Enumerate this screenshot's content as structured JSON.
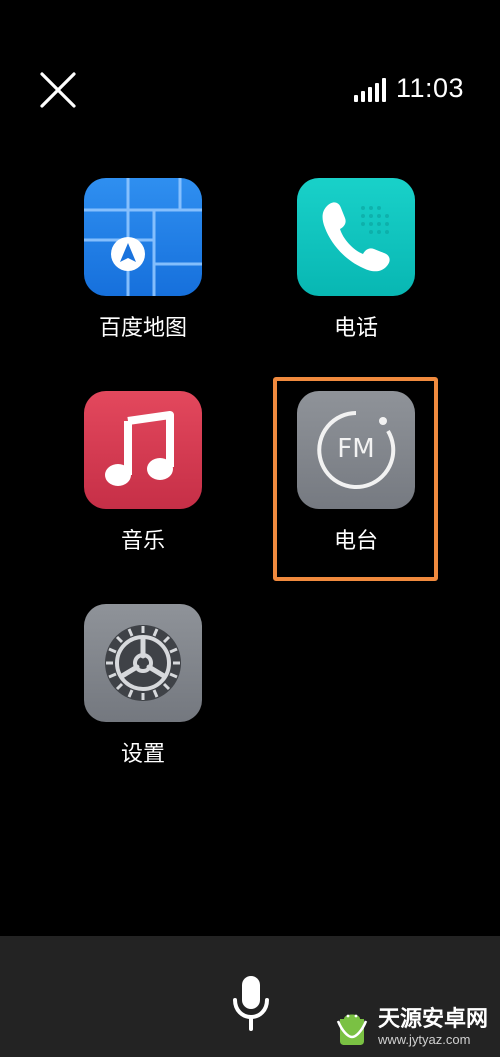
{
  "status_bar": {
    "time": "11:03",
    "signal_icon": "signal-icon"
  },
  "top": {
    "close_icon": "close-icon"
  },
  "apps": [
    {
      "label": "百度地图",
      "icon": "baidu-map-icon",
      "color": "#1f7fe6"
    },
    {
      "label": "电话",
      "icon": "phone-icon",
      "color": "#11c3bf"
    },
    {
      "label": "音乐",
      "icon": "music-icon",
      "color": "#d63a52"
    },
    {
      "label": "电台",
      "icon": "fm-radio-icon",
      "color": "#84878d",
      "highlighted": true,
      "icon_text": "FM"
    },
    {
      "label": "设置",
      "icon": "settings-gear-icon",
      "color": "#84878d"
    }
  ],
  "highlight": {
    "color": "#f08a3e"
  },
  "bottom_bar": {
    "mic_icon": "microphone-icon",
    "background": "#232323"
  },
  "watermark": {
    "title": "天源安卓网",
    "url": "www.jytyaz.com"
  }
}
